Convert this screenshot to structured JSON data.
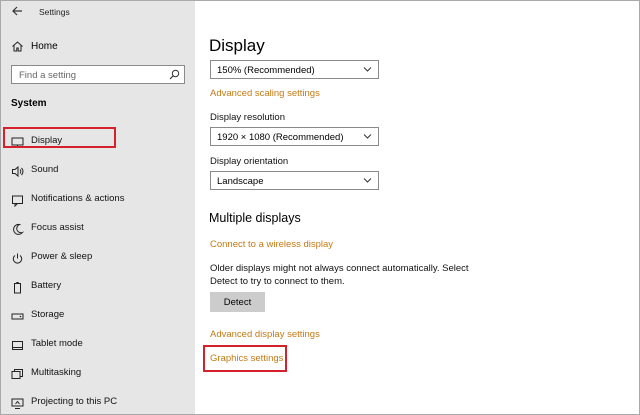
{
  "app": {
    "title": "Settings"
  },
  "sidebar": {
    "home_label": "Home",
    "search_placeholder": "Find a setting",
    "section_heading": "System",
    "items": [
      {
        "label": "Display",
        "icon": "monitor-icon"
      },
      {
        "label": "Sound",
        "icon": "speaker-icon"
      },
      {
        "label": "Notifications & actions",
        "icon": "notification-icon"
      },
      {
        "label": "Focus assist",
        "icon": "moon-icon"
      },
      {
        "label": "Power & sleep",
        "icon": "power-icon"
      },
      {
        "label": "Battery",
        "icon": "battery-icon"
      },
      {
        "label": "Storage",
        "icon": "storage-icon"
      },
      {
        "label": "Tablet mode",
        "icon": "tablet-icon"
      },
      {
        "label": "Multitasking",
        "icon": "multitasking-icon"
      },
      {
        "label": "Projecting to this PC",
        "icon": "projecting-icon"
      }
    ]
  },
  "main": {
    "title": "Display",
    "scale_value": "150% (Recommended)",
    "advanced_scaling_link": "Advanced scaling settings",
    "resolution_label": "Display resolution",
    "resolution_value": "1920 × 1080 (Recommended)",
    "orientation_label": "Display orientation",
    "orientation_value": "Landscape",
    "multiple_displays_heading": "Multiple displays",
    "wireless_link": "Connect to a wireless display",
    "older_displays_text": "Older displays might not always connect automatically. Select Detect to try to connect to them.",
    "detect_button": "Detect",
    "advanced_display_link": "Advanced display settings",
    "graphics_link": "Graphics settings"
  },
  "colors": {
    "accent_link": "#c47a14",
    "highlight_box": "#d6202b",
    "sidebar_bg": "#e6e6e6"
  }
}
